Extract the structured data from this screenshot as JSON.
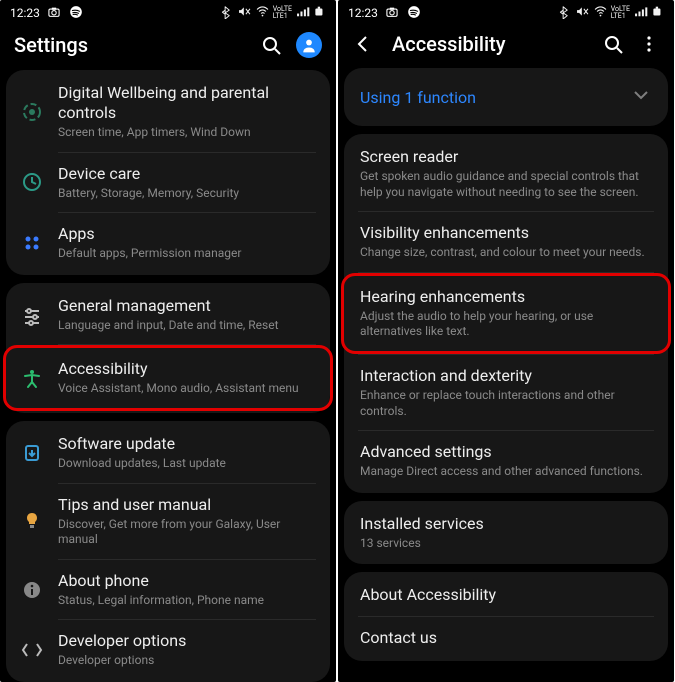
{
  "status": {
    "time": "12:23",
    "lte_top": "VoLTE",
    "lte_bot": "LTE1"
  },
  "left": {
    "header_title": "Settings",
    "groups": [
      {
        "items": [
          {
            "icon": "wellbeing",
            "title": "Digital Wellbeing and parental controls",
            "sub": "Screen time, App timers, Wind Down"
          },
          {
            "icon": "devicecare",
            "title": "Device care",
            "sub": "Battery, Storage, Memory, Security"
          },
          {
            "icon": "apps",
            "title": "Apps",
            "sub": "Default apps, Permission manager"
          }
        ]
      },
      {
        "items": [
          {
            "icon": "general",
            "title": "General management",
            "sub": "Language and input, Date and time, Reset"
          },
          {
            "icon": "accessibility",
            "title": "Accessibility",
            "sub": "Voice Assistant, Mono audio, Assistant menu",
            "highlight": true
          }
        ]
      },
      {
        "items": [
          {
            "icon": "update",
            "title": "Software update",
            "sub": "Download updates, Last update"
          },
          {
            "icon": "tips",
            "title": "Tips and user manual",
            "sub": "Discover, Get more from your Galaxy, User manual"
          },
          {
            "icon": "about",
            "title": "About phone",
            "sub": "Status, Legal information, Phone name"
          },
          {
            "icon": "dev",
            "title": "Developer options",
            "sub": "Developer options"
          }
        ]
      }
    ]
  },
  "right": {
    "header_title": "Accessibility",
    "using_label": "Using 1 function",
    "groups": [
      {
        "items": [
          {
            "title": "Screen reader",
            "sub": "Get spoken audio guidance and special controls that help you navigate without needing to see the screen."
          },
          {
            "title": "Visibility enhancements",
            "sub": "Change size, contrast, and colour to meet your needs."
          },
          {
            "title": "Hearing enhancements",
            "sub": "Adjust the audio to help your hearing, or use alternatives like text.",
            "highlight": true
          },
          {
            "title": "Interaction and dexterity",
            "sub": "Enhance or replace touch interactions and other controls."
          },
          {
            "title": "Advanced settings",
            "sub": "Manage Direct access and other advanced functions."
          }
        ]
      },
      {
        "items": [
          {
            "title": "Installed services",
            "sub": "13 services",
            "sub_blue": true
          }
        ]
      },
      {
        "items": [
          {
            "title": "About Accessibility"
          },
          {
            "title": "Contact us"
          }
        ]
      }
    ]
  }
}
